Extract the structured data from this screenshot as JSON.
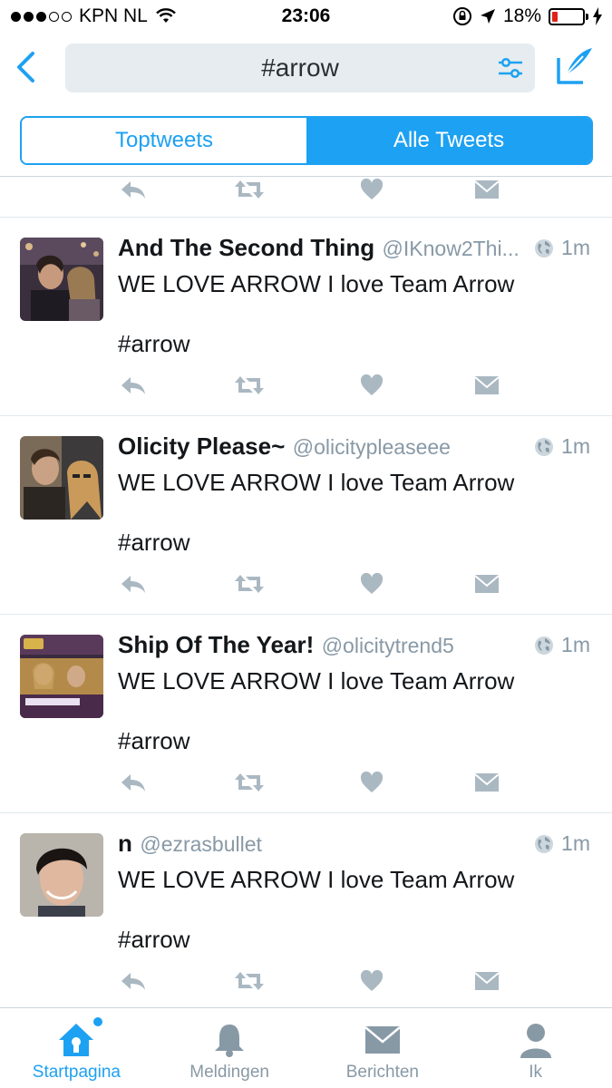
{
  "status_bar": {
    "carrier": "KPN NL",
    "time": "23:06",
    "battery": "18%",
    "battery_level": 0.18
  },
  "header": {
    "search_query": "#arrow"
  },
  "segmented": {
    "tabs": [
      {
        "label": "Toptweets",
        "active": false
      },
      {
        "label": "Alle Tweets",
        "active": true
      }
    ]
  },
  "tweets": [
    {
      "name": "And The Second Thing",
      "handle": "@IKnow2Thi...",
      "time": "1m",
      "text": "WE LOVE ARROW I love Team Arrow",
      "hashtag": "#arrow"
    },
    {
      "name": "Olicity Please~",
      "handle": "@olicitypleaseee",
      "time": "1m",
      "text": "WE LOVE ARROW I love Team Arrow",
      "hashtag": "#arrow"
    },
    {
      "name": "Ship Of The Year!",
      "handle": "@olicitytrend5",
      "time": "1m",
      "text": "WE LOVE ARROW I love Team Arrow",
      "hashtag": "#arrow"
    },
    {
      "name": "n",
      "handle": "@ezrasbullet",
      "time": "1m",
      "text": "WE LOVE ARROW I love Team Arrow",
      "hashtag": "#arrow"
    }
  ],
  "tabbar": [
    {
      "label": "Startpagina",
      "icon": "home-icon",
      "active": true
    },
    {
      "label": "Meldingen",
      "icon": "bell-icon",
      "active": false
    },
    {
      "label": "Berichten",
      "icon": "envelope-icon",
      "active": false
    },
    {
      "label": "Ik",
      "icon": "person-icon",
      "active": false
    }
  ],
  "colors": {
    "accent": "#1da1f2",
    "muted": "#8899a6",
    "battery_low": "#e0221c"
  }
}
